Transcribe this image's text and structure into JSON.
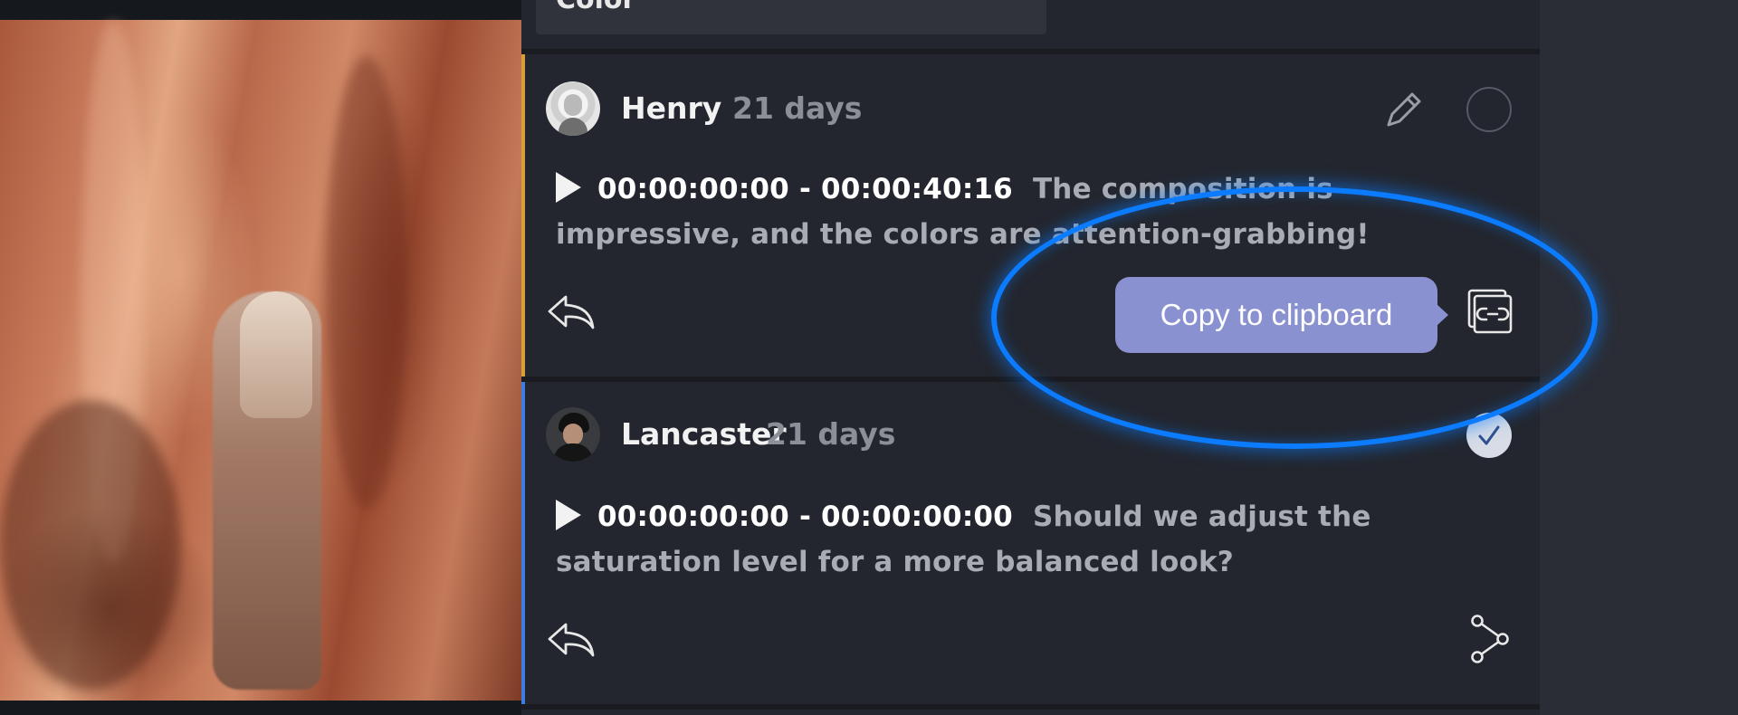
{
  "color_field": {
    "value": "Color"
  },
  "comments": [
    {
      "author": "Henry",
      "age": "21 days",
      "timecode": "00:00:00:00 - 00:00:40:16",
      "text": "The composition is impressive, and the colors are attention-grabbing!",
      "accent_color": "#d9a035",
      "resolved": false
    },
    {
      "author": "Lancaster",
      "age": "21 days",
      "timecode": "00:00:00:00 - 00:00:00:00",
      "text": "Should we adjust the saturation level for a more balanced look?",
      "accent_color": "#3f7de0",
      "resolved": true
    }
  ],
  "tooltip": {
    "label": "Copy to clipboard"
  },
  "colors": {
    "panel_bg": "#23262e",
    "highlight": "#0b7cff",
    "tooltip_bg": "#8a91d0"
  },
  "icons": [
    "play-icon",
    "edit-pencil-icon",
    "resolve-circle-icon",
    "reply-icon",
    "copy-link-icon",
    "check-icon",
    "share-icon"
  ]
}
